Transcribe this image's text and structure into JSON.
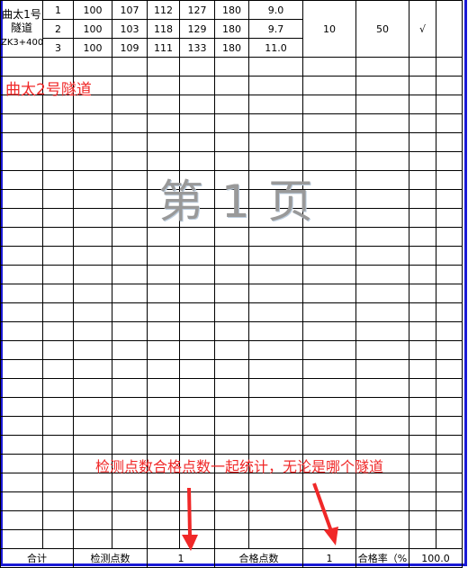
{
  "group": {
    "name_line1": "曲太1号",
    "name_line2": "隧道",
    "station": "ZK3+400",
    "rows": [
      [
        "1",
        "100",
        "107",
        "112",
        "127",
        "180",
        "9.0"
      ],
      [
        "2",
        "100",
        "103",
        "118",
        "129",
        "180",
        "9.7"
      ],
      [
        "3",
        "100",
        "109",
        "111",
        "133",
        "180",
        "11.0"
      ]
    ],
    "col8": "10",
    "col9": "50",
    "check": "√"
  },
  "watermark": "第 1 页",
  "annotations": {
    "tunnel2": "曲太2号隧道",
    "note": "检测点数合格点数一起统计，无论是哪个隧道",
    "color": "#f02828"
  },
  "footer": {
    "total_label": "合计",
    "detect_label": "检测点数",
    "detect_value": "1",
    "pass_label": "合格点数",
    "pass_value": "1",
    "rate_label": "合格率（%",
    "rate_value": "100.0"
  },
  "border_color": "#1a1ad6"
}
